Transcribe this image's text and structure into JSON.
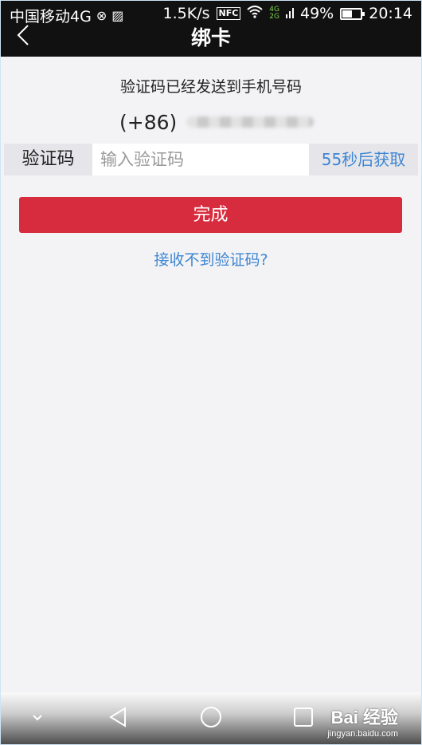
{
  "status_bar": {
    "carrier": "中国移动4G",
    "speed": "1.5K/s",
    "nfc": "NFC",
    "net_4g": "4G",
    "net_2g": "2G",
    "battery": "49%",
    "battery_level": 0.49,
    "time": "20:14"
  },
  "header": {
    "title": "绑卡"
  },
  "main": {
    "sent_message": "验证码已经发送到手机号码",
    "phone_prefix": "(+86)",
    "code_label": "验证码",
    "code_placeholder": "输入验证码",
    "code_value": "",
    "resend_label": "55秒后获取",
    "done_label": "完成",
    "no_code_link": "接收不到验证码?"
  },
  "watermark": {
    "brand": "Bai 经验",
    "url": "jingyan.baidu.com"
  },
  "colors": {
    "accent": "#3d86d3",
    "primary_button": "#d72c3e",
    "header_bg": "#111111"
  }
}
